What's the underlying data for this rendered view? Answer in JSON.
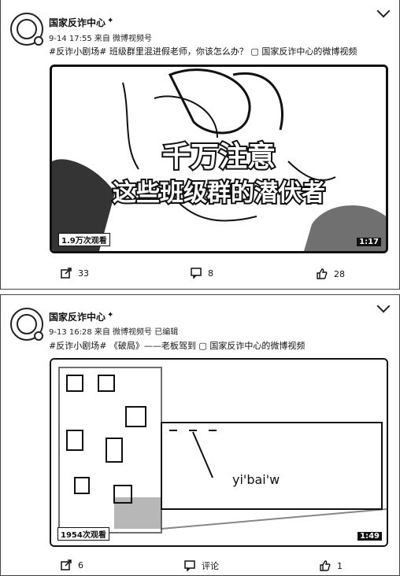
{
  "posts": [
    {
      "author": "国家反诈中心",
      "meta": "9-14 17:55 来自 微博视频号",
      "text": "#反诈小剧场# 班级群里混进假老师，你该怎么办？ ▢ 国家反诈中心的微博视频",
      "video": {
        "title_line1": "千万注意",
        "title_line2": "这些班级群的潜伏者",
        "views": "1.9万次观看",
        "duration": "1:17"
      },
      "actions": {
        "share": "33",
        "comment": "8",
        "like": "28"
      }
    },
    {
      "author": "国家反诈中心",
      "meta": "9-13 16:28 来自 微博视频号 已编辑",
      "text": "#反诈小剧场# 《破局》——老板驾到 ▢ 国家反诈中心的微博视频",
      "video": {
        "overlay_text": "yi'bai'w",
        "views": "1954次观看",
        "duration": "1:49"
      },
      "actions": {
        "share": "6",
        "comment": "评论",
        "like": "1"
      }
    }
  ]
}
